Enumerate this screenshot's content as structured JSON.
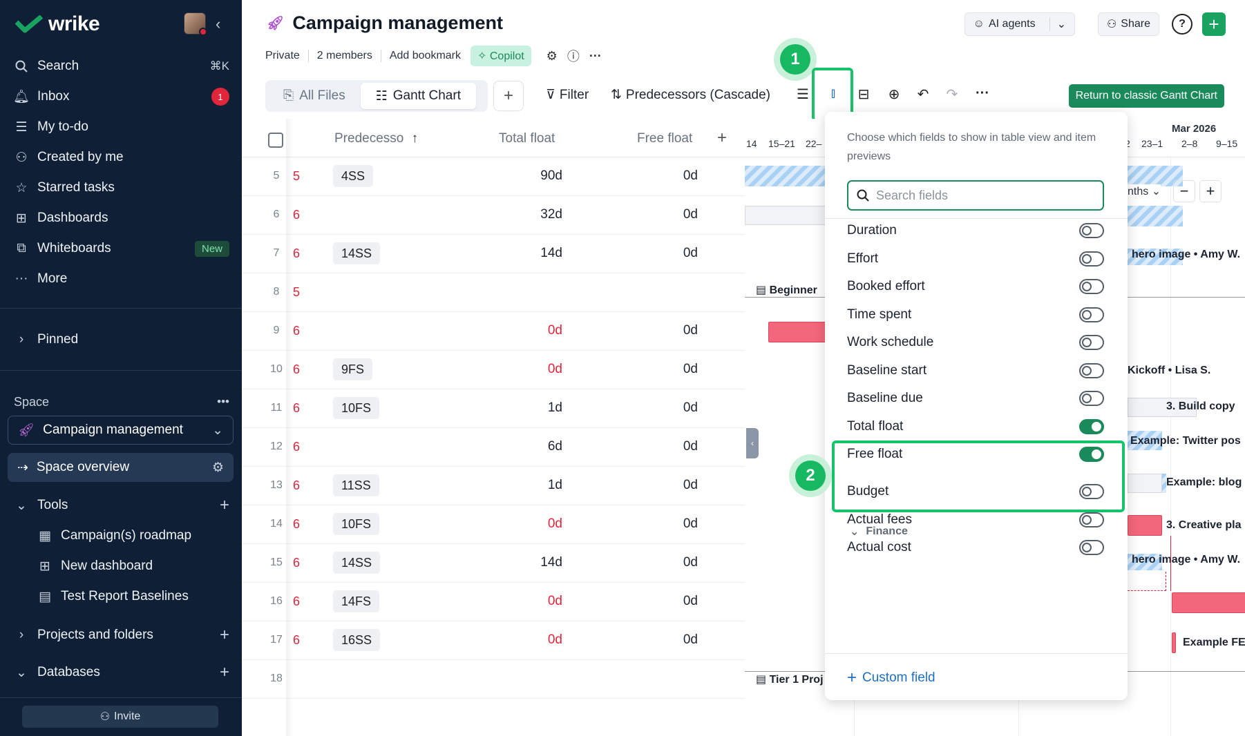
{
  "brand": {
    "name": "wrike",
    "accent": "#1aa360"
  },
  "sidebar": {
    "nav": [
      {
        "label": "Search",
        "icon": "search-icon",
        "shortcut": "⌘K"
      },
      {
        "label": "Inbox",
        "icon": "bell-icon",
        "badge": "1"
      },
      {
        "label": "My to-do",
        "icon": "todo-icon"
      },
      {
        "label": "Created by me",
        "icon": "user-plus-icon"
      },
      {
        "label": "Starred tasks",
        "icon": "star-icon"
      },
      {
        "label": "Dashboards",
        "icon": "dashboard-icon"
      },
      {
        "label": "Whiteboards",
        "icon": "whiteboard-icon",
        "badge": "New"
      },
      {
        "label": "More",
        "icon": "more-icon"
      }
    ],
    "pinned": "Pinned",
    "space_label": "Space",
    "space_name": "Campaign management",
    "space_overview": "Space overview",
    "tools": {
      "label": "Tools",
      "items": [
        "Campaign(s) roadmap",
        "New dashboard",
        "Test Report Baselines"
      ]
    },
    "projects": "Projects and folders",
    "databases": "Databases",
    "invite": "Invite"
  },
  "header": {
    "title": "Campaign management",
    "privacy": "Private",
    "members": "2 members",
    "bookmark": "Add bookmark",
    "copilot": "Copilot",
    "ai_agents": "AI agents",
    "share": "Share",
    "help": "?"
  },
  "toolbar": {
    "tabs": [
      "All Files",
      "Gantt Chart"
    ],
    "filter": "Filter",
    "sort": "Predecessors (Cascade)",
    "return": "Return to classic Gantt Chart"
  },
  "callouts": {
    "one": "1",
    "two": "2"
  },
  "table": {
    "headers": {
      "predecessors": "Predecesso",
      "total_float": "Total float",
      "free_float": "Free float"
    },
    "rows": [
      {
        "n": "5",
        "c": "5",
        "pred": "4SS",
        "tf": "90d",
        "tf_red": false,
        "ff": "0d"
      },
      {
        "n": "6",
        "c": "6",
        "pred": "",
        "tf": "32d",
        "tf_red": false,
        "ff": "0d"
      },
      {
        "n": "7",
        "c": "6",
        "pred": "14SS",
        "tf": "14d",
        "tf_red": false,
        "ff": "0d"
      },
      {
        "n": "8",
        "c": "5",
        "pred": "",
        "tf": "",
        "tf_red": false,
        "ff": ""
      },
      {
        "n": "9",
        "c": "6",
        "pred": "",
        "tf": "0d",
        "tf_red": true,
        "ff": "0d"
      },
      {
        "n": "10",
        "c": "6",
        "pred": "9FS",
        "tf": "0d",
        "tf_red": true,
        "ff": "0d"
      },
      {
        "n": "11",
        "c": "6",
        "pred": "10FS",
        "tf": "1d",
        "tf_red": false,
        "ff": "0d"
      },
      {
        "n": "12",
        "c": "6",
        "pred": "",
        "tf": "6d",
        "tf_red": false,
        "ff": "0d"
      },
      {
        "n": "13",
        "c": "6",
        "pred": "11SS",
        "tf": "1d",
        "tf_red": false,
        "ff": "0d"
      },
      {
        "n": "14",
        "c": "6",
        "pred": "10FS",
        "tf": "0d",
        "tf_red": true,
        "ff": "0d"
      },
      {
        "n": "15",
        "c": "6",
        "pred": "14SS",
        "tf": "14d",
        "tf_red": false,
        "ff": "0d"
      },
      {
        "n": "16",
        "c": "6",
        "pred": "14FS",
        "tf": "0d",
        "tf_red": true,
        "ff": "0d"
      },
      {
        "n": "17",
        "c": "6",
        "pred": "16SS",
        "tf": "0d",
        "tf_red": true,
        "ff": "0d"
      },
      {
        "n": "18",
        "c": "",
        "pred": "",
        "tf": "",
        "tf_red": false,
        "ff": ""
      }
    ]
  },
  "gantt": {
    "month": "Mar 2026",
    "weeks": [
      "14",
      "15–21",
      "22–",
      "2",
      "23–1",
      "2–8",
      "9–15"
    ],
    "zoom": "nths",
    "labels": {
      "beginner": "Beginner",
      "hero1": "hero image • Amy W.",
      "kickoff": "Kickoff • Lisa S.",
      "build": "3. Build copy",
      "twitter": "Example: Twitter pos",
      "blog": "Example: blog",
      "creative": "3. Creative pla",
      "hero2": "hero image • Amy W.",
      "example_fe": "Example FE",
      "tier": "Tier 1 Proj"
    }
  },
  "popover": {
    "description": "Choose which fields to show in table view and item previews",
    "search_placeholder": "Search fields",
    "fields": [
      {
        "label": "Duration",
        "on": false
      },
      {
        "label": "Effort",
        "on": false
      },
      {
        "label": "Booked effort",
        "on": false
      },
      {
        "label": "Time spent",
        "on": false
      },
      {
        "label": "Work schedule",
        "on": false
      },
      {
        "label": "Baseline start",
        "on": false
      },
      {
        "label": "Baseline due",
        "on": false
      },
      {
        "label": "Total float",
        "on": true
      },
      {
        "label": "Free float",
        "on": true
      }
    ],
    "section": "Finance",
    "finance_fields": [
      {
        "label": "Budget",
        "on": false
      },
      {
        "label": "Actual fees",
        "on": false
      },
      {
        "label": "Actual cost",
        "on": false
      }
    ],
    "custom_field": "Custom field"
  }
}
